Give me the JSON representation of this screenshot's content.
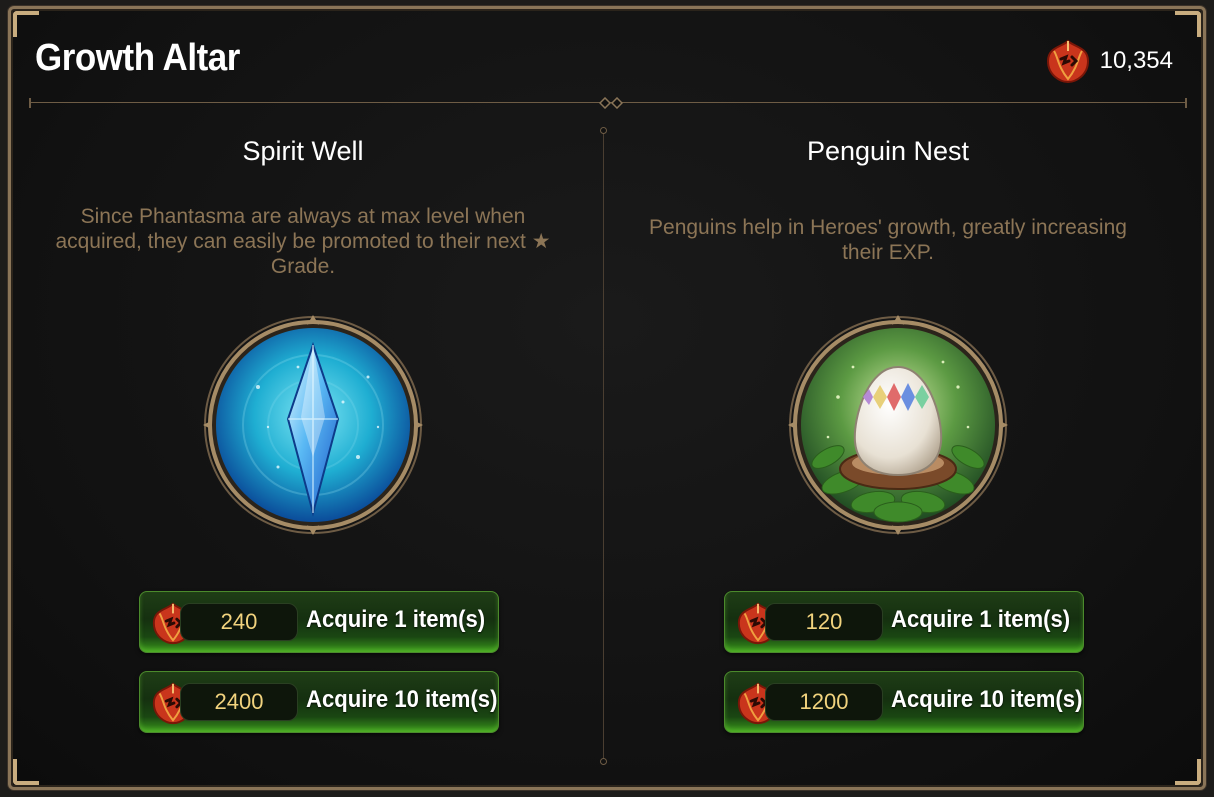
{
  "header": {
    "title": "Growth Altar",
    "currency_icon": "red-leaf-icon",
    "currency_amount": "10,354"
  },
  "colors": {
    "accent_gold": "#8a7558",
    "button_green": "#3b9a1c",
    "price_text": "#f1d37e",
    "desc_text": "#8c7556"
  },
  "altars": [
    {
      "name": "Spirit Well",
      "description": "Since Phantasma are always at max level when acquired, they can easily be promoted to their next ★ Grade.",
      "emblem_icon": "spirit-crystal-icon",
      "options": [
        {
          "price": "240",
          "label": "Acquire 1 item(s)"
        },
        {
          "price": "2400",
          "label": "Acquire 10 item(s)"
        }
      ]
    },
    {
      "name": "Penguin Nest",
      "description": "Penguins help in Heroes' growth, greatly increasing their EXP.",
      "emblem_icon": "penguin-egg-icon",
      "options": [
        {
          "price": "120",
          "label": "Acquire 1 item(s)"
        },
        {
          "price": "1200",
          "label": "Acquire 10 item(s)"
        }
      ]
    }
  ]
}
